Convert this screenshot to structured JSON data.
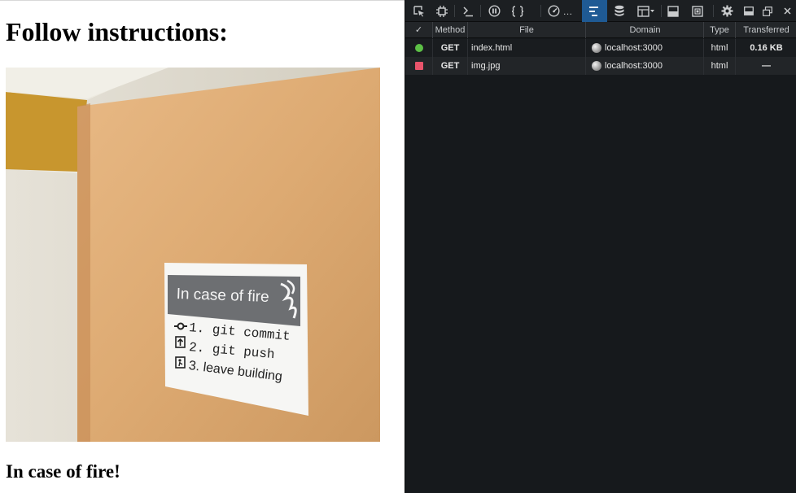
{
  "page": {
    "heading": "Follow instructions:",
    "photo": {
      "sign_title": "In case of fire",
      "sign_items": [
        "1. git commit",
        "2. git push",
        "3. leave building"
      ]
    },
    "caption": "In case of fire!"
  },
  "devtools": {
    "toolbar": {
      "more_label": "…",
      "icons": [
        "inspect-icon",
        "responsive-icon",
        "console-icon",
        "debugger-icon",
        "style-editor-icon",
        "performance-icon",
        "network-icon",
        "storage-icon",
        "layout-icon",
        "screenshot-icon",
        "frame-icon",
        "settings-icon",
        "dock-icon",
        "undock-icon",
        "close-icon"
      ]
    },
    "network": {
      "columns": {
        "status": "✓",
        "method": "Method",
        "file": "File",
        "domain": "Domain",
        "type": "Type",
        "transferred": "Transferred"
      },
      "rows": [
        {
          "status": "ok",
          "status_color": "#5cc046",
          "method": "GET",
          "file": "index.html",
          "domain": "localhost:3000",
          "type": "html",
          "transferred": "0.16 KB"
        },
        {
          "status": "error",
          "status_color": "#e8546b",
          "method": "GET",
          "file": "img.jpg",
          "domain": "localhost:3000",
          "type": "html",
          "transferred": "—"
        }
      ]
    },
    "colors": {
      "active_tab": "#1f5a94",
      "panel_bg": "#16191c"
    }
  }
}
